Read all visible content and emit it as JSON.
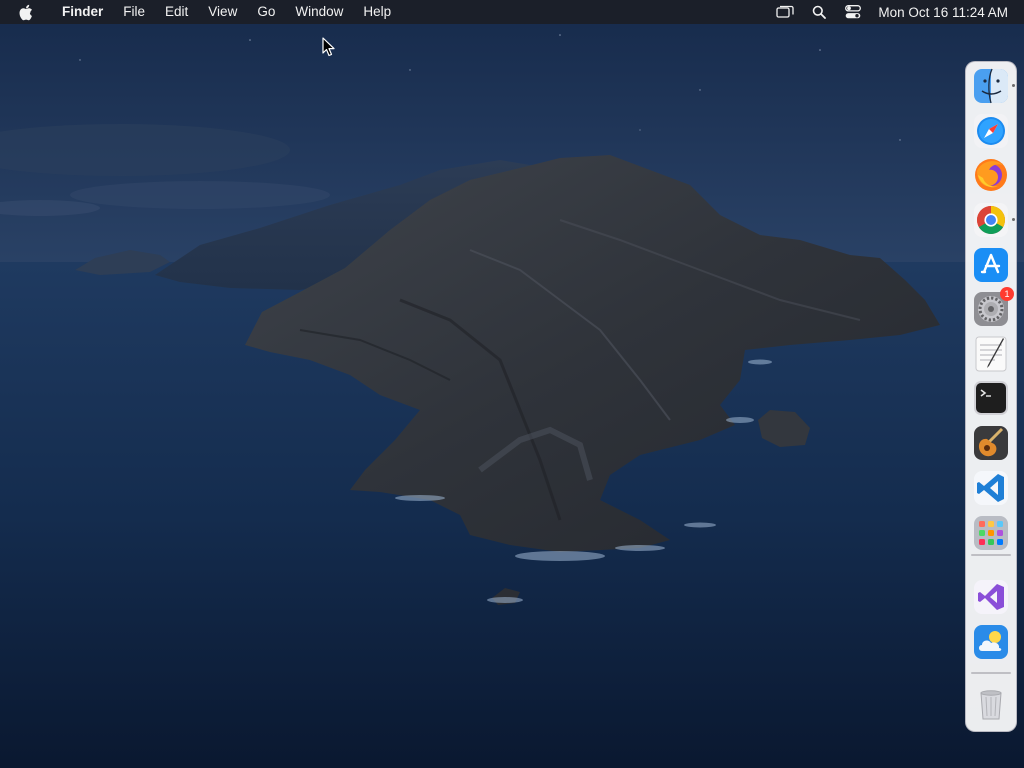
{
  "menubar": {
    "apple_icon": "apple-logo-icon",
    "app_name": "Finder",
    "menus": [
      "File",
      "Edit",
      "View",
      "Go",
      "Window",
      "Help"
    ],
    "status_icons": [
      "screen-mirroring-icon",
      "spotlight-search-icon",
      "control-center-icon"
    ],
    "clock": "Mon Oct 16  11:24 AM"
  },
  "desktop": {
    "wallpaper": "macOS Catalina island"
  },
  "dock": {
    "apps": [
      {
        "name": "Finder",
        "icon": "finder-icon",
        "running": true
      },
      {
        "name": "Safari",
        "icon": "safari-icon",
        "running": false
      },
      {
        "name": "Firefox",
        "icon": "firefox-icon",
        "running": false
      },
      {
        "name": "Google Chrome",
        "icon": "chrome-icon",
        "running": true
      },
      {
        "name": "App Store",
        "icon": "app-store-icon",
        "running": false
      },
      {
        "name": "System Preferences",
        "icon": "system-preferences-icon",
        "running": false,
        "badge": "1"
      },
      {
        "name": "TextEdit",
        "icon": "textedit-icon",
        "running": false
      },
      {
        "name": "Terminal",
        "icon": "terminal-icon",
        "running": false
      },
      {
        "name": "GarageBand",
        "icon": "garageband-icon",
        "running": false
      },
      {
        "name": "Visual Studio Code",
        "icon": "vscode-icon",
        "running": false
      },
      {
        "name": "Launchpad",
        "icon": "launchpad-icon",
        "running": false
      }
    ],
    "recent_apps": [
      {
        "name": "Visual Studio",
        "icon": "visual-studio-icon"
      },
      {
        "name": "Weather",
        "icon": "weather-icon"
      }
    ],
    "trash": {
      "name": "Trash",
      "icon": "trash-icon"
    }
  },
  "colors": {
    "menubar_bg": "#1c1e26",
    "ocean": "#122744",
    "dock_bg": "#ffffff"
  }
}
